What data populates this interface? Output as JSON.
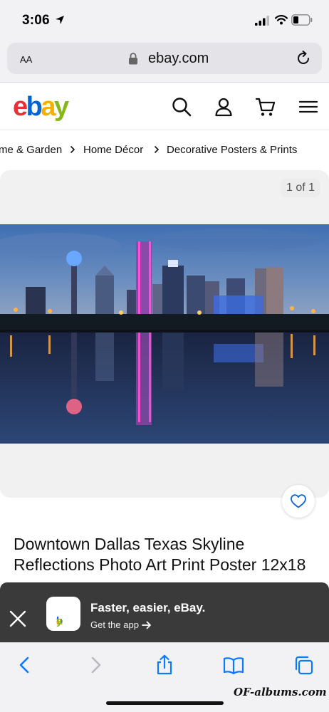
{
  "status_bar": {
    "time": "3:06"
  },
  "browser": {
    "text_size_label": "AA",
    "domain": "ebay.com"
  },
  "header": {
    "logo": {
      "e": "e",
      "b": "b",
      "a": "a",
      "y": "y"
    },
    "icons": [
      "search-icon",
      "account-icon",
      "cart-icon",
      "menu-icon"
    ]
  },
  "breadcrumb": {
    "items": [
      "me & Garden",
      "Home Décor",
      "Decorative Posters & Prints"
    ]
  },
  "gallery": {
    "counter": "1 of 1"
  },
  "listing": {
    "title": "Downtown Dallas Texas Skyline Reflections Photo Art Print Poster 12x18"
  },
  "app_banner": {
    "title": "Faster, easier, eBay.",
    "cta": "Get the app",
    "icon_text": {
      "e": "e",
      "b": "b",
      "a": "a",
      "y": "y"
    }
  },
  "watermark": "OF-albums.com",
  "colors": {
    "ebay_red": "#e53238",
    "ebay_blue": "#0064d2",
    "ebay_yellow": "#f5af02",
    "ebay_green": "#86b817",
    "ios_blue": "#0a7aff",
    "banner_bg": "#3a3a3b"
  }
}
